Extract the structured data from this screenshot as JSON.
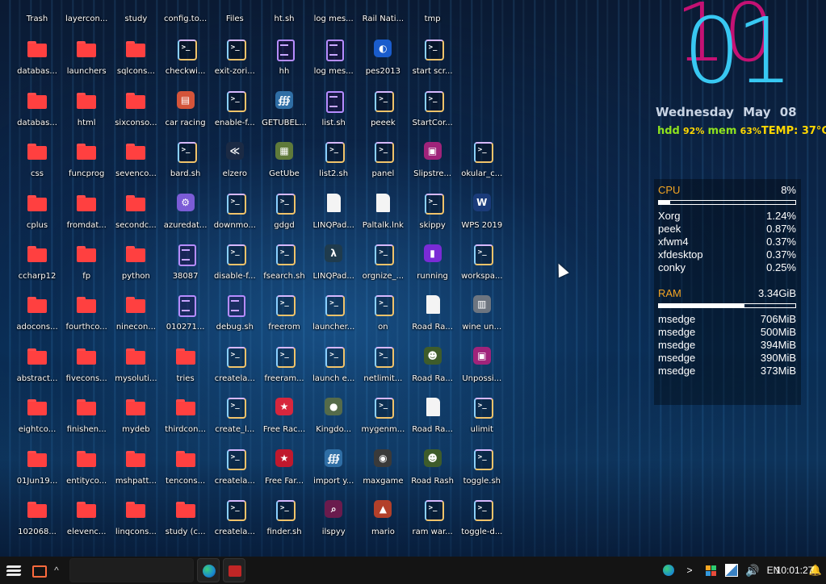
{
  "desktop": {
    "columns": [
      [
        {
          "label": "Trash",
          "icon": "trash-icon",
          "kind": "trash",
          "cut": true
        },
        {
          "label": "databas...",
          "icon": "folder-icon",
          "kind": "folder"
        },
        {
          "label": "databas...",
          "icon": "folder-icon",
          "kind": "folder"
        },
        {
          "label": "css",
          "icon": "folder-icon",
          "kind": "folder"
        },
        {
          "label": "cplus",
          "icon": "folder-icon",
          "kind": "folder"
        },
        {
          "label": "ccharp12",
          "icon": "folder-icon",
          "kind": "folder"
        },
        {
          "label": "adocons...",
          "icon": "folder-icon",
          "kind": "folder"
        },
        {
          "label": "abstract...",
          "icon": "folder-icon",
          "kind": "folder"
        },
        {
          "label": "eightco...",
          "icon": "folder-icon",
          "kind": "folder"
        },
        {
          "label": "01Jun19...",
          "icon": "folder-icon",
          "kind": "folder"
        },
        {
          "label": "102068...",
          "icon": "folder-icon",
          "kind": "folder"
        }
      ],
      [
        {
          "label": "layercon...",
          "icon": "folder-icon",
          "kind": "folder",
          "cut": true
        },
        {
          "label": "launchers",
          "icon": "folder-icon",
          "kind": "folder"
        },
        {
          "label": "html",
          "icon": "folder-icon",
          "kind": "folder"
        },
        {
          "label": "funcprog",
          "icon": "folder-icon",
          "kind": "folder"
        },
        {
          "label": "fromdat...",
          "icon": "folder-icon",
          "kind": "folder"
        },
        {
          "label": "fp",
          "icon": "folder-icon",
          "kind": "folder"
        },
        {
          "label": "fourthco...",
          "icon": "folder-icon",
          "kind": "folder"
        },
        {
          "label": "fivecons...",
          "icon": "folder-icon",
          "kind": "folder"
        },
        {
          "label": "finishen...",
          "icon": "folder-icon",
          "kind": "folder"
        },
        {
          "label": "entityco...",
          "icon": "folder-icon",
          "kind": "folder"
        },
        {
          "label": "elevenc...",
          "icon": "folder-icon",
          "kind": "folder"
        }
      ],
      [
        {
          "label": "study",
          "icon": "folder-icon",
          "kind": "folder",
          "cut": true
        },
        {
          "label": "sqlcons...",
          "icon": "folder-icon",
          "kind": "folder"
        },
        {
          "label": "sixconso...",
          "icon": "folder-icon",
          "kind": "folder"
        },
        {
          "label": "sevenco...",
          "icon": "folder-icon",
          "kind": "folder"
        },
        {
          "label": "secondc...",
          "icon": "folder-icon",
          "kind": "folder"
        },
        {
          "label": "python",
          "icon": "folder-icon",
          "kind": "folder"
        },
        {
          "label": "ninecon...",
          "icon": "folder-icon",
          "kind": "folder"
        },
        {
          "label": "mysoluti...",
          "icon": "folder-icon",
          "kind": "folder"
        },
        {
          "label": "mydeb",
          "icon": "folder-icon",
          "kind": "folder"
        },
        {
          "label": "mshpatt...",
          "icon": "folder-icon",
          "kind": "folder"
        },
        {
          "label": "linqcons...",
          "icon": "folder-icon",
          "kind": "folder"
        }
      ],
      [
        {
          "label": "config.to...",
          "icon": "script-icon",
          "kind": "script",
          "cut": true
        },
        {
          "label": "checkwi...",
          "icon": "script-icon",
          "kind": "script"
        },
        {
          "label": "car racing",
          "icon": "car-racing-icon",
          "kind": "app",
          "color": "#d4543a",
          "glyph": "▤"
        },
        {
          "label": "bard.sh",
          "icon": "script-icon",
          "kind": "script"
        },
        {
          "label": "azuredat...",
          "icon": "azure-data-icon",
          "kind": "app",
          "color": "#7b5cd6",
          "glyph": "⚙"
        },
        {
          "label": "38087",
          "icon": "text-file-icon",
          "kind": "text"
        },
        {
          "label": "010271...",
          "icon": "text-file-icon",
          "kind": "text"
        },
        {
          "label": "tries",
          "icon": "folder-icon",
          "kind": "folder"
        },
        {
          "label": "thirdcon...",
          "icon": "folder-icon",
          "kind": "folder"
        },
        {
          "label": "tencons...",
          "icon": "folder-icon",
          "kind": "folder"
        },
        {
          "label": "study (c...",
          "icon": "folder-icon",
          "kind": "folder"
        }
      ],
      [
        {
          "label": "Files",
          "icon": "files-icon",
          "kind": "app",
          "color": "#3a3f47",
          "glyph": "▤",
          "cut": true
        },
        {
          "label": "exit-zori...",
          "icon": "script-icon",
          "kind": "script"
        },
        {
          "label": "enable-f...",
          "icon": "script-icon",
          "kind": "script"
        },
        {
          "label": "elzero",
          "icon": "elzero-icon",
          "kind": "app",
          "color": "#1b2a44",
          "glyph": "≪"
        },
        {
          "label": "downmo...",
          "icon": "script-icon",
          "kind": "script"
        },
        {
          "label": "disable-f...",
          "icon": "script-icon",
          "kind": "script"
        },
        {
          "label": "debug.sh",
          "icon": "text-file-icon",
          "kind": "text"
        },
        {
          "label": "createla...",
          "icon": "script-icon",
          "kind": "script"
        },
        {
          "label": "create_l...",
          "icon": "script-icon",
          "kind": "script"
        },
        {
          "label": "createla...",
          "icon": "script-icon",
          "kind": "script"
        },
        {
          "label": "createla...",
          "icon": "script-icon",
          "kind": "script"
        }
      ],
      [
        {
          "label": "ht.sh",
          "icon": "script-icon",
          "kind": "script",
          "cut": true
        },
        {
          "label": "hh",
          "icon": "text-file-icon",
          "kind": "text"
        },
        {
          "label": "GETUBEL...",
          "icon": "python-icon",
          "kind": "app",
          "color": "#2f6ea5",
          "glyph": "∰"
        },
        {
          "label": "GetUbe",
          "icon": "film-icon",
          "kind": "app",
          "color": "#5f7a3a",
          "glyph": "▦"
        },
        {
          "label": "gdgd",
          "icon": "script-icon",
          "kind": "script"
        },
        {
          "label": "fsearch.sh",
          "icon": "script-icon",
          "kind": "script"
        },
        {
          "label": "freerom",
          "icon": "script-icon",
          "kind": "script"
        },
        {
          "label": "freeram...",
          "icon": "script-icon",
          "kind": "script"
        },
        {
          "label": "Free Rac...",
          "icon": "game-icon",
          "kind": "app",
          "color": "#d7263d",
          "glyph": "★"
        },
        {
          "label": "Free Far...",
          "icon": "trophy-icon",
          "kind": "app",
          "color": "#c0182d",
          "glyph": "★"
        },
        {
          "label": "finder.sh",
          "icon": "script-icon",
          "kind": "script"
        }
      ],
      [
        {
          "label": "log mes...",
          "icon": "text-file-icon",
          "kind": "text",
          "cut": true
        },
        {
          "label": "log mes...",
          "icon": "text-file-icon",
          "kind": "text"
        },
        {
          "label": "list.sh",
          "icon": "text-file-icon",
          "kind": "text"
        },
        {
          "label": "list2.sh",
          "icon": "script-icon",
          "kind": "script"
        },
        {
          "label": "LINQPad...",
          "icon": "document-icon",
          "kind": "doc"
        },
        {
          "label": "LINQPad...",
          "icon": "lambda-icon",
          "kind": "app",
          "color": "#1f3b4d",
          "glyph": "λ"
        },
        {
          "label": "launcher...",
          "icon": "script-icon",
          "kind": "script"
        },
        {
          "label": "launch e...",
          "icon": "script-icon",
          "kind": "script"
        },
        {
          "label": "Kingdo...",
          "icon": "kingdom-icon",
          "kind": "app",
          "color": "#556b4a",
          "glyph": "●"
        },
        {
          "label": "import y...",
          "icon": "python-icon",
          "kind": "app",
          "color": "#2f6ea5",
          "glyph": "∰"
        },
        {
          "label": "ilspyy",
          "icon": "search-tool-icon",
          "kind": "app",
          "color": "#6a1b4d",
          "glyph": "⌕"
        }
      ],
      [
        {
          "label": "Rail Nati...",
          "icon": "game-icon",
          "kind": "app",
          "color": "#8a1c1c",
          "glyph": "▤",
          "cut": true
        },
        {
          "label": "pes2013",
          "icon": "pes-icon",
          "kind": "app",
          "color": "#1a5ccc",
          "glyph": "◐"
        },
        {
          "label": "peeek",
          "icon": "script-icon",
          "kind": "script"
        },
        {
          "label": "panel",
          "icon": "script-icon",
          "kind": "script"
        },
        {
          "label": "Paltalk.lnk",
          "icon": "document-icon",
          "kind": "doc"
        },
        {
          "label": "orgnize_...",
          "icon": "script-icon",
          "kind": "script"
        },
        {
          "label": "on",
          "icon": "script-icon",
          "kind": "script"
        },
        {
          "label": "netlimit...",
          "icon": "script-icon",
          "kind": "script"
        },
        {
          "label": "mygenm...",
          "icon": "script-icon",
          "kind": "script"
        },
        {
          "label": "maxgame",
          "icon": "gamepad-icon",
          "kind": "app",
          "color": "#3a3a3a",
          "glyph": "◉"
        },
        {
          "label": "mario",
          "icon": "mario-icon",
          "kind": "app",
          "color": "#b3402a",
          "glyph": "▲"
        }
      ],
      [
        {
          "label": "tmp",
          "icon": "text-file-icon",
          "kind": "text",
          "cut": true
        },
        {
          "label": "start scr...",
          "icon": "script-icon",
          "kind": "script"
        },
        {
          "label": "StartCor...",
          "icon": "script-icon",
          "kind": "script"
        },
        {
          "label": "Slipstre...",
          "icon": "slipstream-icon",
          "kind": "app",
          "color": "#a0237a",
          "glyph": "▣"
        },
        {
          "label": "skippy",
          "icon": "script-icon",
          "kind": "script"
        },
        {
          "label": "running",
          "icon": "switch-icon",
          "kind": "app",
          "color": "#7a2bd6",
          "glyph": "▮"
        },
        {
          "label": "Road Ra...",
          "icon": "document-icon",
          "kind": "doc"
        },
        {
          "label": "Road Ra...",
          "icon": "road-rash-icon",
          "kind": "app",
          "color": "#3e5c2b",
          "glyph": "☻"
        },
        {
          "label": "Road Ra...",
          "icon": "document-icon",
          "kind": "doc"
        },
        {
          "label": "Road Rash",
          "icon": "road-rash-icon",
          "kind": "app",
          "color": "#3e5c2b",
          "glyph": "☻"
        },
        {
          "label": "ram war...",
          "icon": "script-icon",
          "kind": "script"
        }
      ],
      [
        {
          "label": "okular_c...",
          "icon": "script-icon",
          "kind": "script",
          "row": 3
        },
        {
          "label": "WPS 2019",
          "icon": "wps-icon",
          "kind": "app",
          "color": "#1a3b7a",
          "glyph": "W",
          "row": 4
        },
        {
          "label": "workspa...",
          "icon": "script-icon",
          "kind": "script",
          "row": 5
        },
        {
          "label": "wine un...",
          "icon": "wine-icon",
          "kind": "app",
          "color": "#6d7580",
          "glyph": "▥",
          "row": 6
        },
        {
          "label": "Unpossi...",
          "icon": "unpossible-icon",
          "kind": "app",
          "color": "#a0237a",
          "glyph": "▣",
          "row": 7
        },
        {
          "label": "ulimit",
          "icon": "script-icon",
          "kind": "script",
          "row": 8
        },
        {
          "label": "toggle.sh",
          "icon": "script-icon",
          "kind": "script",
          "row": 9
        },
        {
          "label": "toggle-d...",
          "icon": "script-icon",
          "kind": "script",
          "row": 10
        }
      ]
    ]
  },
  "clock": {
    "minute": "01",
    "hour_shadow": "10",
    "weekday": "Wednesday",
    "date": "May 08",
    "hdd_label": "hdd",
    "hdd_value": "92%",
    "mem_label": "mem",
    "mem_value": "63%",
    "temp": "TEMP: 37°C"
  },
  "system": {
    "cpu": {
      "label": "CPU",
      "value": "8%",
      "fraction": 0.08,
      "processes": [
        {
          "name": "Xorg",
          "value": "1.24%"
        },
        {
          "name": "peek",
          "value": "0.87%"
        },
        {
          "name": "xfwm4",
          "value": "0.37%"
        },
        {
          "name": "xfdesktop",
          "value": "0.37%"
        },
        {
          "name": "conky",
          "value": "0.25%"
        }
      ]
    },
    "ram": {
      "label": "RAM",
      "value": "3.34GiB",
      "fraction": 0.63,
      "processes": [
        {
          "name": "msedge",
          "value": "706MiB"
        },
        {
          "name": "msedge",
          "value": "500MiB"
        },
        {
          "name": "msedge",
          "value": "394MiB"
        },
        {
          "name": "msedge",
          "value": "390MiB"
        },
        {
          "name": "msedge",
          "value": "373MiB"
        }
      ]
    }
  },
  "taskbar": {
    "language": "EN",
    "time": "10:01:27",
    "expand_glyph": "^",
    "tray_arrow": ">",
    "volume_glyph": "🔊",
    "bell_glyph": "🔔"
  }
}
